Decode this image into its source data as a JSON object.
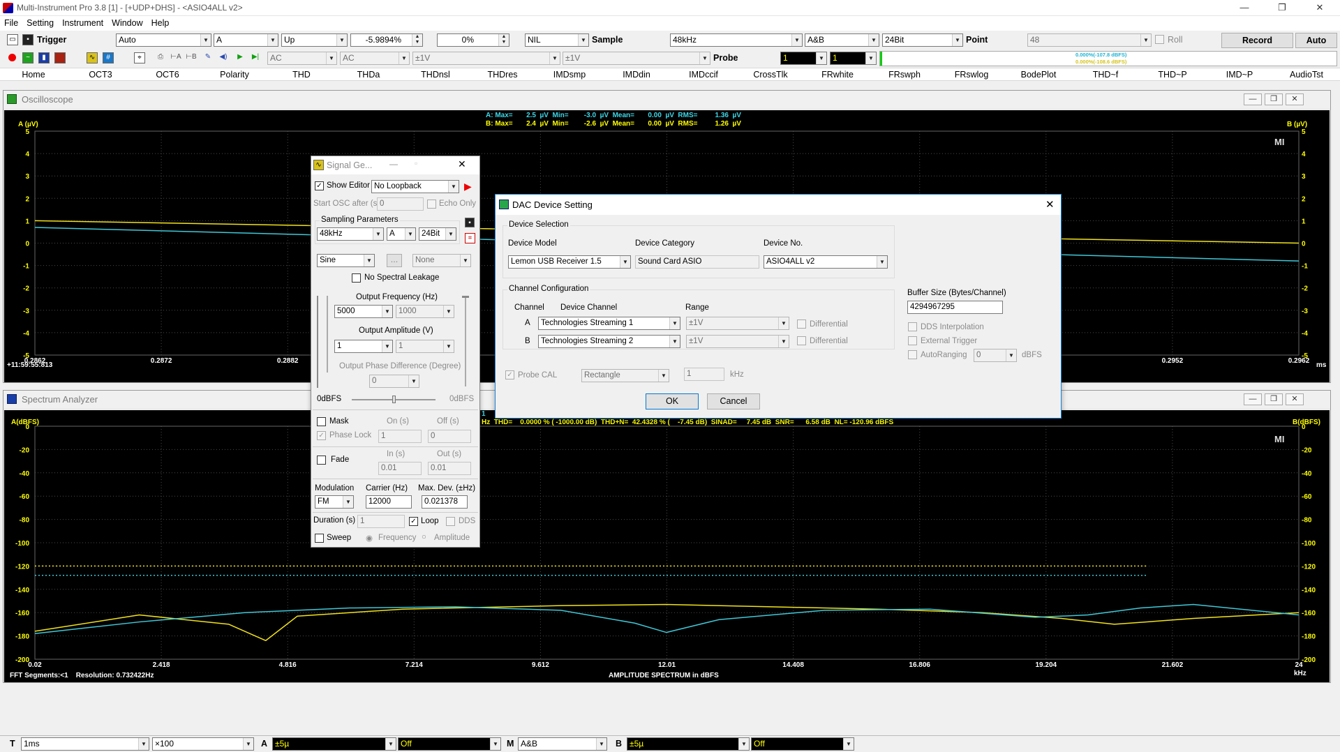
{
  "window": {
    "title": "Multi-Instrument Pro 3.8 [1]   -   [+UDP+DHS]   -   <ASIO4ALL v2>",
    "minimize": "—",
    "restore": "❐",
    "close": "✕"
  },
  "menu": [
    "File",
    "Setting",
    "Instrument",
    "Window",
    "Help"
  ],
  "toolbar1": {
    "trigger_label": "Trigger",
    "trigger_mode": "Auto",
    "trigger_channel": "A",
    "trigger_edge": "Up",
    "trigger_level": "-5.9894%",
    "trigger_percent": "0%",
    "nil": "NIL",
    "sample_label": "Sample",
    "sample_rate": "48kHz",
    "channels": "A&B",
    "bits": "24Bit",
    "point_label": "Point",
    "points": "48",
    "roll_label": "Roll",
    "record_label": "Record",
    "auto_label": "Auto"
  },
  "toolbar2": {
    "coupling_a": "AC",
    "coupling_b": "AC",
    "range_a": "±1V",
    "range_b": "±1V",
    "probe_label": "Probe",
    "probe_a": "1",
    "probe_b": "1",
    "meter_a": "0.000%(-107.8 dBFS)",
    "meter_b": "0.000%(-108.6 dBFS)"
  },
  "tabs": [
    "Home",
    "OCT3",
    "OCT6",
    "Polarity",
    "THD",
    "THDa",
    "THDnsl",
    "THDres",
    "IMDsmp",
    "IMDdin",
    "IMDccif",
    "CrossTlk",
    "FRwhite",
    "FRswph",
    "FRswlog",
    "BodePlot",
    "THD~f",
    "THD~P",
    "IMD~P",
    "AudioTst"
  ],
  "osc": {
    "title": "Oscilloscope",
    "ylabel_a": "A (µV)",
    "ylabel_b": "B (µV)",
    "stats_a": "A: Max=       2.5  µV  Min=        -3.0  µV  Mean=       0.00  µV  RMS=         1.36  µV",
    "stats_b": "B: Max=       2.4  µV  Min=        -2.6  µV  Mean=       0.00  µV  RMS=         1.26  µV",
    "timestamp": "+11:59:55:813",
    "xunit": "ms",
    "logo": "MI"
  },
  "osc_chart": {
    "type": "line",
    "xlim": [
      0.2862,
      0.2962
    ],
    "ylim": [
      -5,
      5
    ],
    "x_ticks": [
      "0.2862",
      "0.2872",
      "0.2882",
      "0.2952",
      "0.2962"
    ],
    "y_ticks": [
      "5",
      "4",
      "3",
      "2",
      "1",
      "0",
      "-1",
      "-2",
      "-3",
      "-4",
      "-5"
    ],
    "series": [
      {
        "color": "#f2e21a",
        "x": [
          0.2862,
          0.2962
        ],
        "y": [
          1.0,
          0.0
        ]
      },
      {
        "color": "#3fc8d8",
        "x": [
          0.2862,
          0.2962
        ],
        "y": [
          0.7,
          -0.8
        ]
      }
    ]
  },
  "spec": {
    "title": "Spectrum Analyzer",
    "ylabel_a": "A(dBFS)",
    "ylabel_b": "B(dBFS)",
    "stats_line1": "1     k",
    "stats_line2": "Hz  THD=    0.0000 % ( -1000.00 dB)  THD+N=  42.4328 % (    -7.45 dB)  SINAD=     7.45 dB  SNR=      6.58 dB  NL= -120.96 dBFS",
    "footer_left": "FFT Segments:<1    Resolution: 0.732422Hz",
    "xtitle": "AMPLITUDE SPECTRUM in dBFS",
    "xunit": "kHz",
    "logo": "MI"
  },
  "spec_chart": {
    "type": "line",
    "xlim": [
      0.02,
      24
    ],
    "ylim": [
      -200,
      0
    ],
    "x_ticks": [
      "0.02",
      "2.418",
      "4.816",
      "7.214",
      "9.612",
      "12.01",
      "14.408",
      "16.806",
      "19.204",
      "21.602",
      "24"
    ],
    "y_ticks": [
      "0",
      "-20",
      "-40",
      "-60",
      "-80",
      "-100",
      "-120",
      "-140",
      "-160",
      "-180",
      "-200"
    ],
    "noise_level_a": -120,
    "noise_level_b": -128,
    "series": [
      {
        "color": "#f2e21a",
        "x": [
          0.02,
          2,
          3.7,
          4.4,
          5,
          7,
          10,
          12,
          14,
          16,
          18,
          19.5,
          20.5,
          22,
          24
        ],
        "y": [
          -176,
          -162,
          -170,
          -184,
          -163,
          -157,
          -154,
          -153,
          -155,
          -157,
          -160,
          -165,
          -170,
          -165,
          -160
        ]
      },
      {
        "color": "#3fc8d8",
        "x": [
          0.02,
          2,
          4,
          6,
          8,
          10,
          11.4,
          12,
          13,
          15,
          17,
          19,
          20,
          21,
          22,
          24
        ],
        "y": [
          -178,
          -168,
          -160,
          -156,
          -155,
          -158,
          -169,
          -177,
          -166,
          -158,
          -157,
          -164,
          -162,
          -156,
          -153,
          -162
        ]
      }
    ]
  },
  "siggen": {
    "title": "Signal Ge...",
    "show_editor": "Show Editor",
    "loopback": "No Loopback",
    "start_osc": "Start OSC after (s)",
    "start_osc_value": "0",
    "echo_only": "Echo Only",
    "sampling_params": "Sampling Parameters",
    "sg_rate": "48kHz",
    "sg_channel": "A",
    "sg_bits": "24Bit",
    "waveform": "Sine",
    "dots": "...",
    "none": "None",
    "no_leakage": "No Spectral Leakage",
    "freq_label": "Output Frequency (Hz)",
    "freq_a": "5000",
    "freq_b": "1000",
    "amp_label": "Output Amplitude (V)",
    "amp_a": "1",
    "amp_b": "1",
    "phase_label": "Output Phase Difference (Degree)",
    "phase": "0",
    "dbfs_left": "0dBFS",
    "dbfs_right": "0dBFS",
    "mask": "Mask",
    "on_s": "On (s)",
    "off_s": "Off (s)",
    "phase_lock": "Phase Lock",
    "on_val": "1",
    "off_val": "0",
    "fade": "Fade",
    "in_s": "In (s)",
    "out_s": "Out (s)",
    "in_val": "0.01",
    "out_val": "0.01",
    "modulation": "Modulation",
    "carrier": "Carrier (Hz)",
    "maxdev": "Max. Dev. (±Hz)",
    "mod_value": "FM",
    "carrier_value": "12000",
    "maxdev_value": "0.021378",
    "duration": "Duration (s)",
    "duration_value": "1",
    "loop": "Loop",
    "dds": "DDS",
    "sweep": "Sweep",
    "frequency": "Frequency",
    "amplitude": "Amplitude"
  },
  "dac": {
    "title": "DAC Device Setting",
    "device_selection": "Device Selection",
    "device_model": "Device Model",
    "device_category": "Device Category",
    "device_no": "Device No.",
    "model_value": "Lemon USB Receiver 1.5",
    "category_value": "Sound Card ASIO",
    "no_value": "ASIO4ALL v2",
    "channel_config": "Channel Configuration",
    "channel": "Channel",
    "device_channel": "Device Channel",
    "range": "Range",
    "ch_a": "A",
    "ch_b": "B",
    "dev_ch_a": "Technologies Streaming 1",
    "dev_ch_b": "Technologies Streaming 2",
    "range_a": "±1V",
    "range_b": "±1V",
    "differential": "Differential",
    "buffer_label": "Buffer Size (Bytes/Channel)",
    "buffer_value": "4294967295",
    "dds_interp": "DDS Interpolation",
    "ext_trigger": "External Trigger",
    "autoranging": "AutoRanging",
    "auto_value": "0",
    "dbfs": "dBFS",
    "probe_cal": "Probe CAL",
    "rect": "Rectangle",
    "cal_freq": "1",
    "khz": "kHz",
    "ok": "OK",
    "cancel": "Cancel"
  },
  "bottom": {
    "t_label": "T",
    "time_div": "1ms",
    "zoom": "×100",
    "a_label": "A",
    "a_scale": "±5µ",
    "a_off": "Off",
    "m_label": "M",
    "m_value": "A&B",
    "b_label": "B",
    "b_scale": "±5µ",
    "b_off": "Off"
  }
}
